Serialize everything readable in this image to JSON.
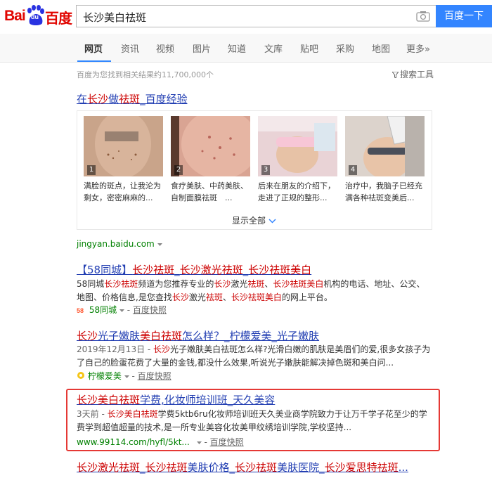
{
  "logo": {
    "latin": "Bai",
    "du": "du",
    "chinese": "百度"
  },
  "search": {
    "query": "长沙美白祛斑",
    "button": "百度一下"
  },
  "tabs": [
    "网页",
    "资讯",
    "视频",
    "图片",
    "知道",
    "文库",
    "贴吧",
    "采购",
    "地图",
    "更多»"
  ],
  "result_count": "百度为您找到相关结果约11,700,000个",
  "search_tools": "搜索工具",
  "experience": {
    "title_a": "在",
    "title_b": "长沙",
    "title_c": "做",
    "title_d": "祛斑",
    "title_e": "_百度经验",
    "images": [
      {
        "num": "1",
        "caption": "满脸的斑点，让我沦为剩女，密密麻麻的..."
      },
      {
        "num": "2",
        "caption": "食疗美肤、中药美肤、自制面膜祛斑　..."
      },
      {
        "num": "3",
        "caption": "后来在朋友的介绍下，走进了正规的整形..."
      },
      {
        "num": "4",
        "caption": "治疗中，我脑子已经充满各种祛斑变美后..."
      }
    ],
    "show_all": "显示全部",
    "url": "jingyan.baidu.com"
  },
  "results": [
    {
      "title": "【58同城】长沙祛斑_长沙激光祛斑_长沙祛斑美白",
      "desc_1": "58同城",
      "desc_2": "长沙",
      "desc_3": "祛斑",
      "desc_4": "频道为您推荐专业的",
      "desc_5": "长沙",
      "desc_6": "激光",
      "desc_7": "祛斑",
      "desc_8": "、",
      "desc_9": "长沙",
      "desc_10": "祛斑美白",
      "desc_11": "机构的电话、地址、公交、地图、价格信息,是您查找",
      "desc_12": "长沙",
      "desc_13": "激光",
      "desc_14": "祛斑",
      "desc_15": "、",
      "desc_16": "长沙",
      "desc_17": "祛斑美白",
      "desc_18": "的网上平台。",
      "site": "58同城",
      "snapshot": "百度快照"
    },
    {
      "title": "长沙光子嫩肤美白祛斑怎么样？_柠檬爱美_光子嫩肤",
      "date": "2019年12月13日 - ",
      "desc": "光子嫩肤美白祛斑怎么样?光滑白嫩的肌肤是美眉们的爱,很多女孩子为了自己的脸蛋花费了大量的金钱,都没什么效果,听说光子嫩肤能解决掉色斑和美白问...",
      "site": "柠檬爱美",
      "snapshot": "百度快照"
    },
    {
      "title": "长沙美白祛斑学费,化妆师培训班_天久美容",
      "date": "3天前 - ",
      "desc_a": "长沙美白祛斑",
      "desc_b": "学费5ktb6ru化妆师培训班天久美业商学院致力于让万千学子花至少的学费学到超值超量的技术,是一所专业美容化妆美甲纹绣培训学院,学校坚持...",
      "site": "www.99114.com/hyfl/5kt...",
      "snapshot": "百度快照"
    },
    {
      "title": "长沙激光祛斑_长沙祛斑美肤价格_长沙祛斑美肤医院_长沙爱思特祛斑..."
    }
  ]
}
